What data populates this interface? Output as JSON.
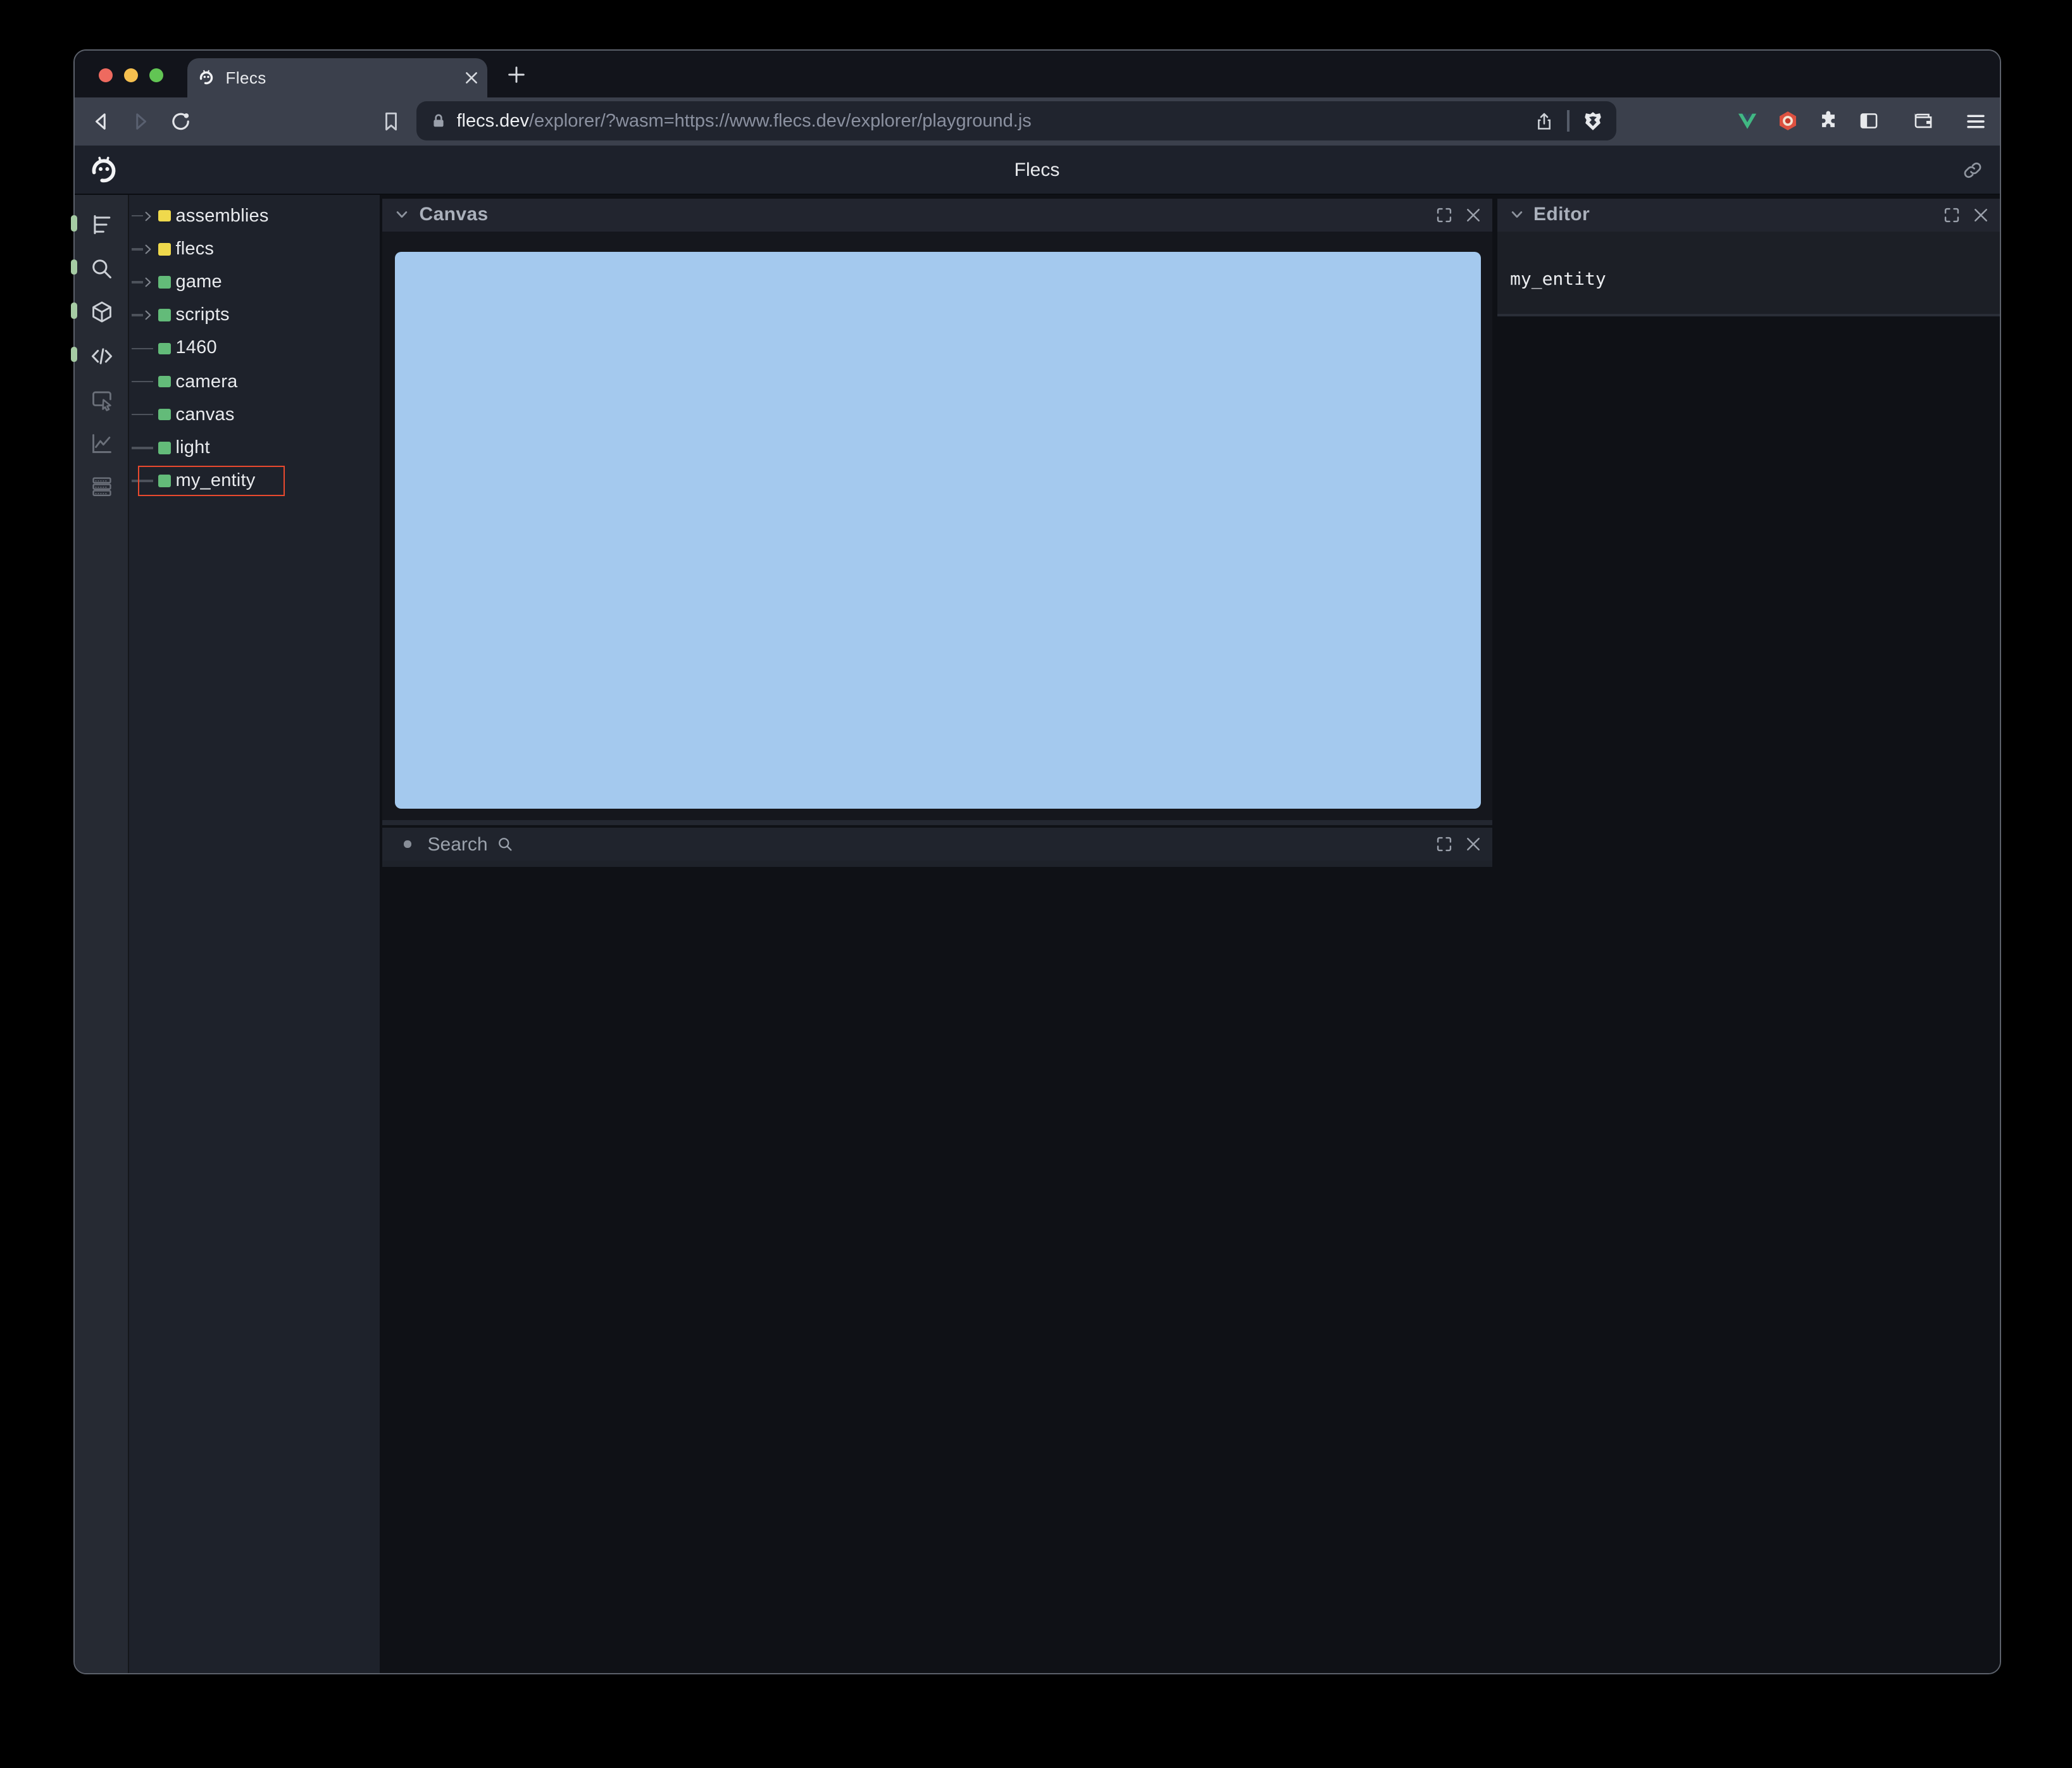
{
  "browser": {
    "tab_title": "Flecs",
    "url": {
      "host": "flecs.dev",
      "path": "/explorer/?wasm=https://www.flecs.dev/explorer/playground.js"
    }
  },
  "app": {
    "title": "Flecs",
    "sidebar_icons": [
      "entity-tree",
      "search",
      "assets-cube",
      "code",
      "inspect",
      "statistics",
      "commands"
    ],
    "tree": {
      "items": [
        {
          "label": "assemblies",
          "icon_color": "#efd94c",
          "expandable": true,
          "selected": false
        },
        {
          "label": "flecs",
          "icon_color": "#efd94c",
          "expandable": true,
          "selected": false
        },
        {
          "label": "game",
          "icon_color": "#63bb79",
          "expandable": true,
          "selected": false
        },
        {
          "label": "scripts",
          "icon_color": "#63bb79",
          "expandable": true,
          "selected": false
        },
        {
          "label": "1460",
          "icon_color": "#63bb79",
          "expandable": false,
          "selected": false
        },
        {
          "label": "camera",
          "icon_color": "#63bb79",
          "expandable": false,
          "selected": false
        },
        {
          "label": "canvas",
          "icon_color": "#63bb79",
          "expandable": false,
          "selected": false
        },
        {
          "label": "light",
          "icon_color": "#63bb79",
          "expandable": false,
          "selected": false
        },
        {
          "label": "my_entity",
          "icon_color": "#63bb79",
          "expandable": false,
          "selected": true
        }
      ]
    },
    "panels": {
      "canvas": {
        "title": "Canvas",
        "viewport_color": "#a4c9ee"
      },
      "search": {
        "title": "Search"
      },
      "editor": {
        "title": "Editor",
        "content": "my_entity"
      }
    },
    "colors": {
      "selection_outline": "#e8492e",
      "module_icon": "#efd94c",
      "entity_icon": "#63bb79",
      "accent_pill": "#a6cca4"
    }
  }
}
